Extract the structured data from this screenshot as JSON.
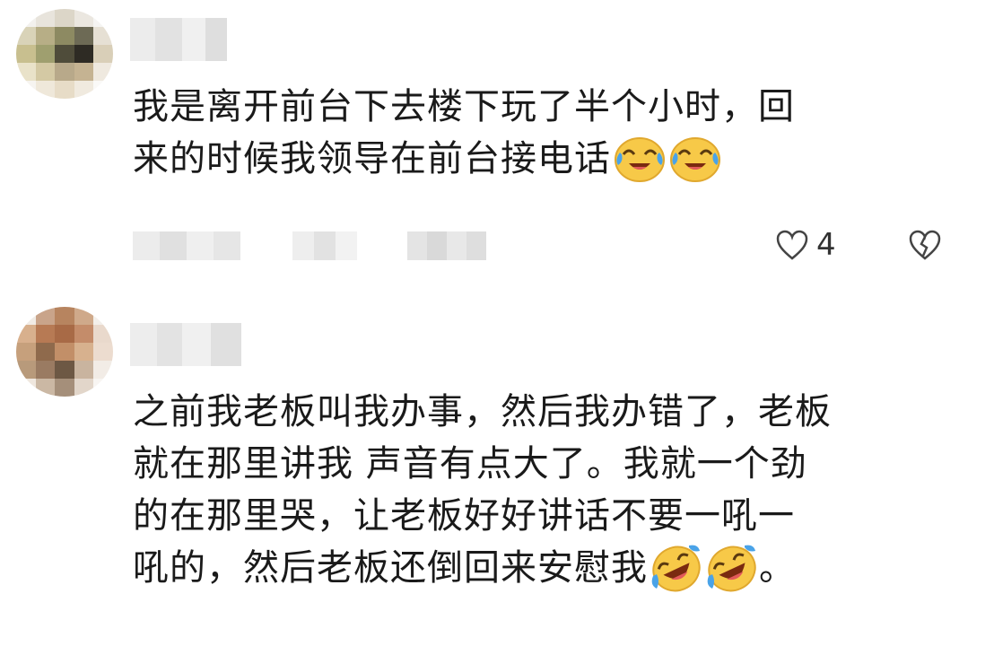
{
  "comments": [
    {
      "lines": [
        "我是离开前台下去楼下玩了半个小时，回",
        "来的时候我领导在前台接电话"
      ],
      "like_count": "4",
      "emoji": "crying-laughing-emoji"
    },
    {
      "lines": [
        "之前我老板叫我办事，然后我办错了，老板",
        "就在那里讲我 声音有点大了。我就一个劲",
        "的在那里哭，让老板好好讲话不要一吼一",
        "吼的，然后老板还倒回来安慰我"
      ],
      "end_punct": "。",
      "emoji": "rolling-laughing-emoji"
    }
  ],
  "icons": {
    "like": "heart-outline-icon",
    "dislike": "broken-heart-icon"
  },
  "colors": {
    "text": "#1a1a1a",
    "icon": "#444444",
    "emoji_face": "#f7c948",
    "emoji_tear": "#4aa3e8"
  }
}
